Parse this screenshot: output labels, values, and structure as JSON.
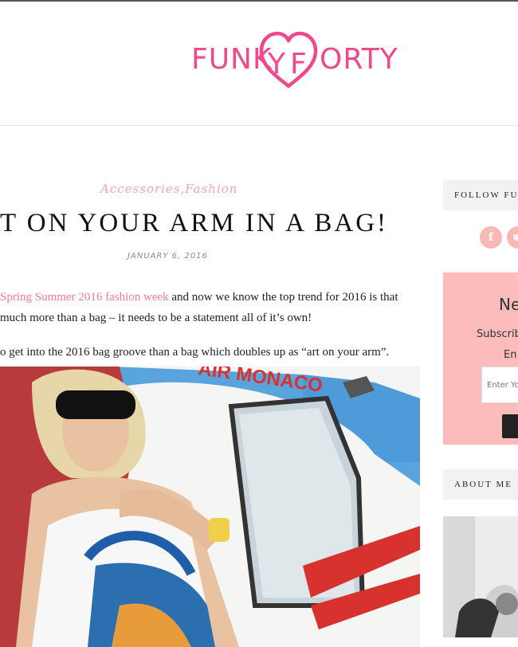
{
  "header": {
    "logo_left": "FUNK",
    "logo_y": "Y",
    "logo_f": "F",
    "logo_right": "ORTY"
  },
  "post": {
    "categories": [
      "Accessories",
      "Fashion"
    ],
    "category_separator": ",",
    "title": "T ON YOUR ARM IN A BAG!",
    "date": "JANUARY 6, 2016",
    "para1_link": "Spring Summer 2016 fashion week",
    "para1_text": " and now we know the top trend for 2016 is that",
    "para1_line2": "much more than a bag – it needs to be a statement all of it’s own!",
    "para2": "o get into the 2016 bag groove than a bag which doubles up as “art on your arm”.",
    "photo_sign_text": "AIR MONACO"
  },
  "sidebar": {
    "follow_title": "FOLLOW FU",
    "social_icons": [
      "facebook-icon",
      "twitter-icon"
    ],
    "facebook_glyph": "f",
    "newsletter_title": "Ne",
    "newsletter_sub": "Subscrib",
    "newsletter_en": "En",
    "email_placeholder": "Enter Yo",
    "about_title": "ABOUT ME"
  },
  "colors": {
    "brand_pink": "#f0488b",
    "link_pink": "#f37a9c",
    "category_pink": "#f6a3b8",
    "social_pink": "#f8b8b4",
    "newsletter_bg": "#fdbcbc",
    "widget_title_bg": "#f2f2f2"
  }
}
